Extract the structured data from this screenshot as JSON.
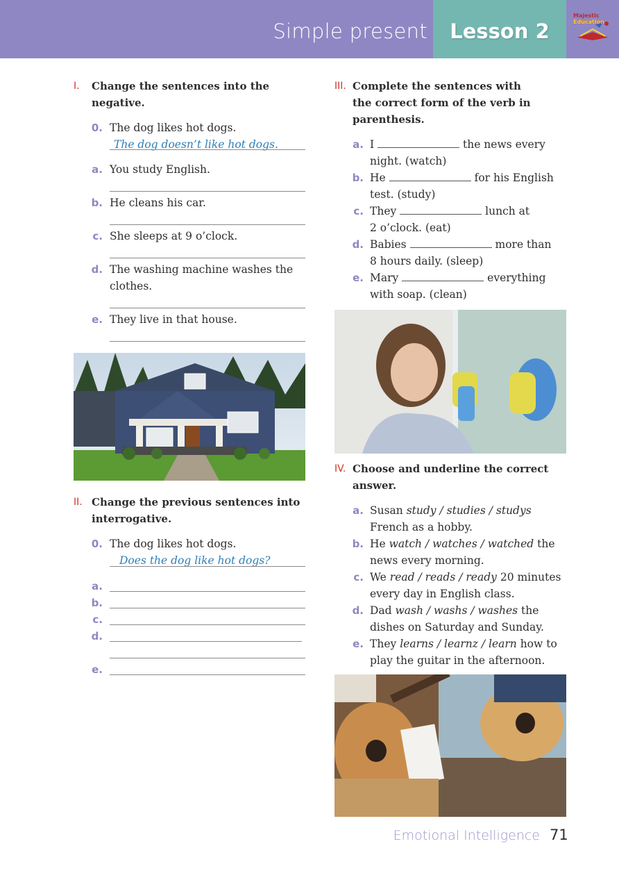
{
  "header": {
    "subject": "Simple present",
    "lesson": "Lesson 2",
    "logo_line1": "Majestic",
    "logo_line2": "Education"
  },
  "section1": {
    "number": "I.",
    "title_line1": "Change the sentences into the",
    "title_line2": "negative.",
    "example_label": "0.",
    "example_text": "The dog likes hot dogs.",
    "example_answer": "The dog doesn’t like hot dogs.",
    "items": [
      {
        "label": "a.",
        "text": "You study English."
      },
      {
        "label": "b.",
        "text": "He cleans his car."
      },
      {
        "label": "c.",
        "text": "She sleeps at 9 o’clock."
      },
      {
        "label": "d.",
        "text_line1": "The washing machine washes the",
        "text_line2": "clothes."
      },
      {
        "label": "e.",
        "text": "They live in that house."
      }
    ]
  },
  "section2": {
    "number": "II.",
    "title_line1": "Change the previous sentences into",
    "title_line2": "interrogative.",
    "example_label": "0.",
    "example_text": "The dog likes hot dogs.",
    "example_answer": "Does the dog like hot dogs?",
    "labels": [
      "a.",
      "b.",
      "c.",
      "d.",
      "e."
    ]
  },
  "section3": {
    "number": "III.",
    "title_line1": "Complete the sentences with",
    "title_line2": "the correct form of the verb in",
    "title_line3": "parenthesis.",
    "items": [
      {
        "label": "a.",
        "before": "I",
        "after": "the news every",
        "line2": "night. (watch)"
      },
      {
        "label": "b.",
        "before": "He",
        "after": "for his English",
        "line2": "test. (study)"
      },
      {
        "label": "c.",
        "before": "They",
        "after": "lunch at",
        "line2": "2 o’clock. (eat)"
      },
      {
        "label": "d.",
        "before": "Babies",
        "after": "more than",
        "line2": "8 hours daily. (sleep)"
      },
      {
        "label": "e.",
        "before": "Mary",
        "after": "everything",
        "line2": "with soap. (clean)"
      }
    ]
  },
  "section4": {
    "number": "IV.",
    "title_line1": "Choose and underline the correct",
    "title_line2": "answer.",
    "items": [
      {
        "label": "a.",
        "before": "Susan",
        "options": "study / studies / studys",
        "after": "",
        "line2": "French as a hobby."
      },
      {
        "label": "b.",
        "before": "He",
        "options": "watch / watches / watched",
        "after": "the",
        "line2": "news every morning."
      },
      {
        "label": "c.",
        "before": "We",
        "options": "read / reads / ready",
        "after": "20 minutes",
        "line2": "every day in English class."
      },
      {
        "label": "d.",
        "before": "Dad",
        "options": "wash / washs / washes",
        "after": "the",
        "line2": "dishes on Saturday and Sunday."
      },
      {
        "label": "e.",
        "before": "They",
        "options": "learns / learnz / learn",
        "after": "how to",
        "line2": "play the guitar in the afternoon."
      }
    ]
  },
  "footer": {
    "book_title": "Emotional Intelligence",
    "page_number": "71"
  },
  "colors": {
    "header_purple": "#8f87c3",
    "lesson_teal": "#74b7b1",
    "section_number_red": "#d1362b",
    "answer_blue": "#2f7fb6"
  }
}
